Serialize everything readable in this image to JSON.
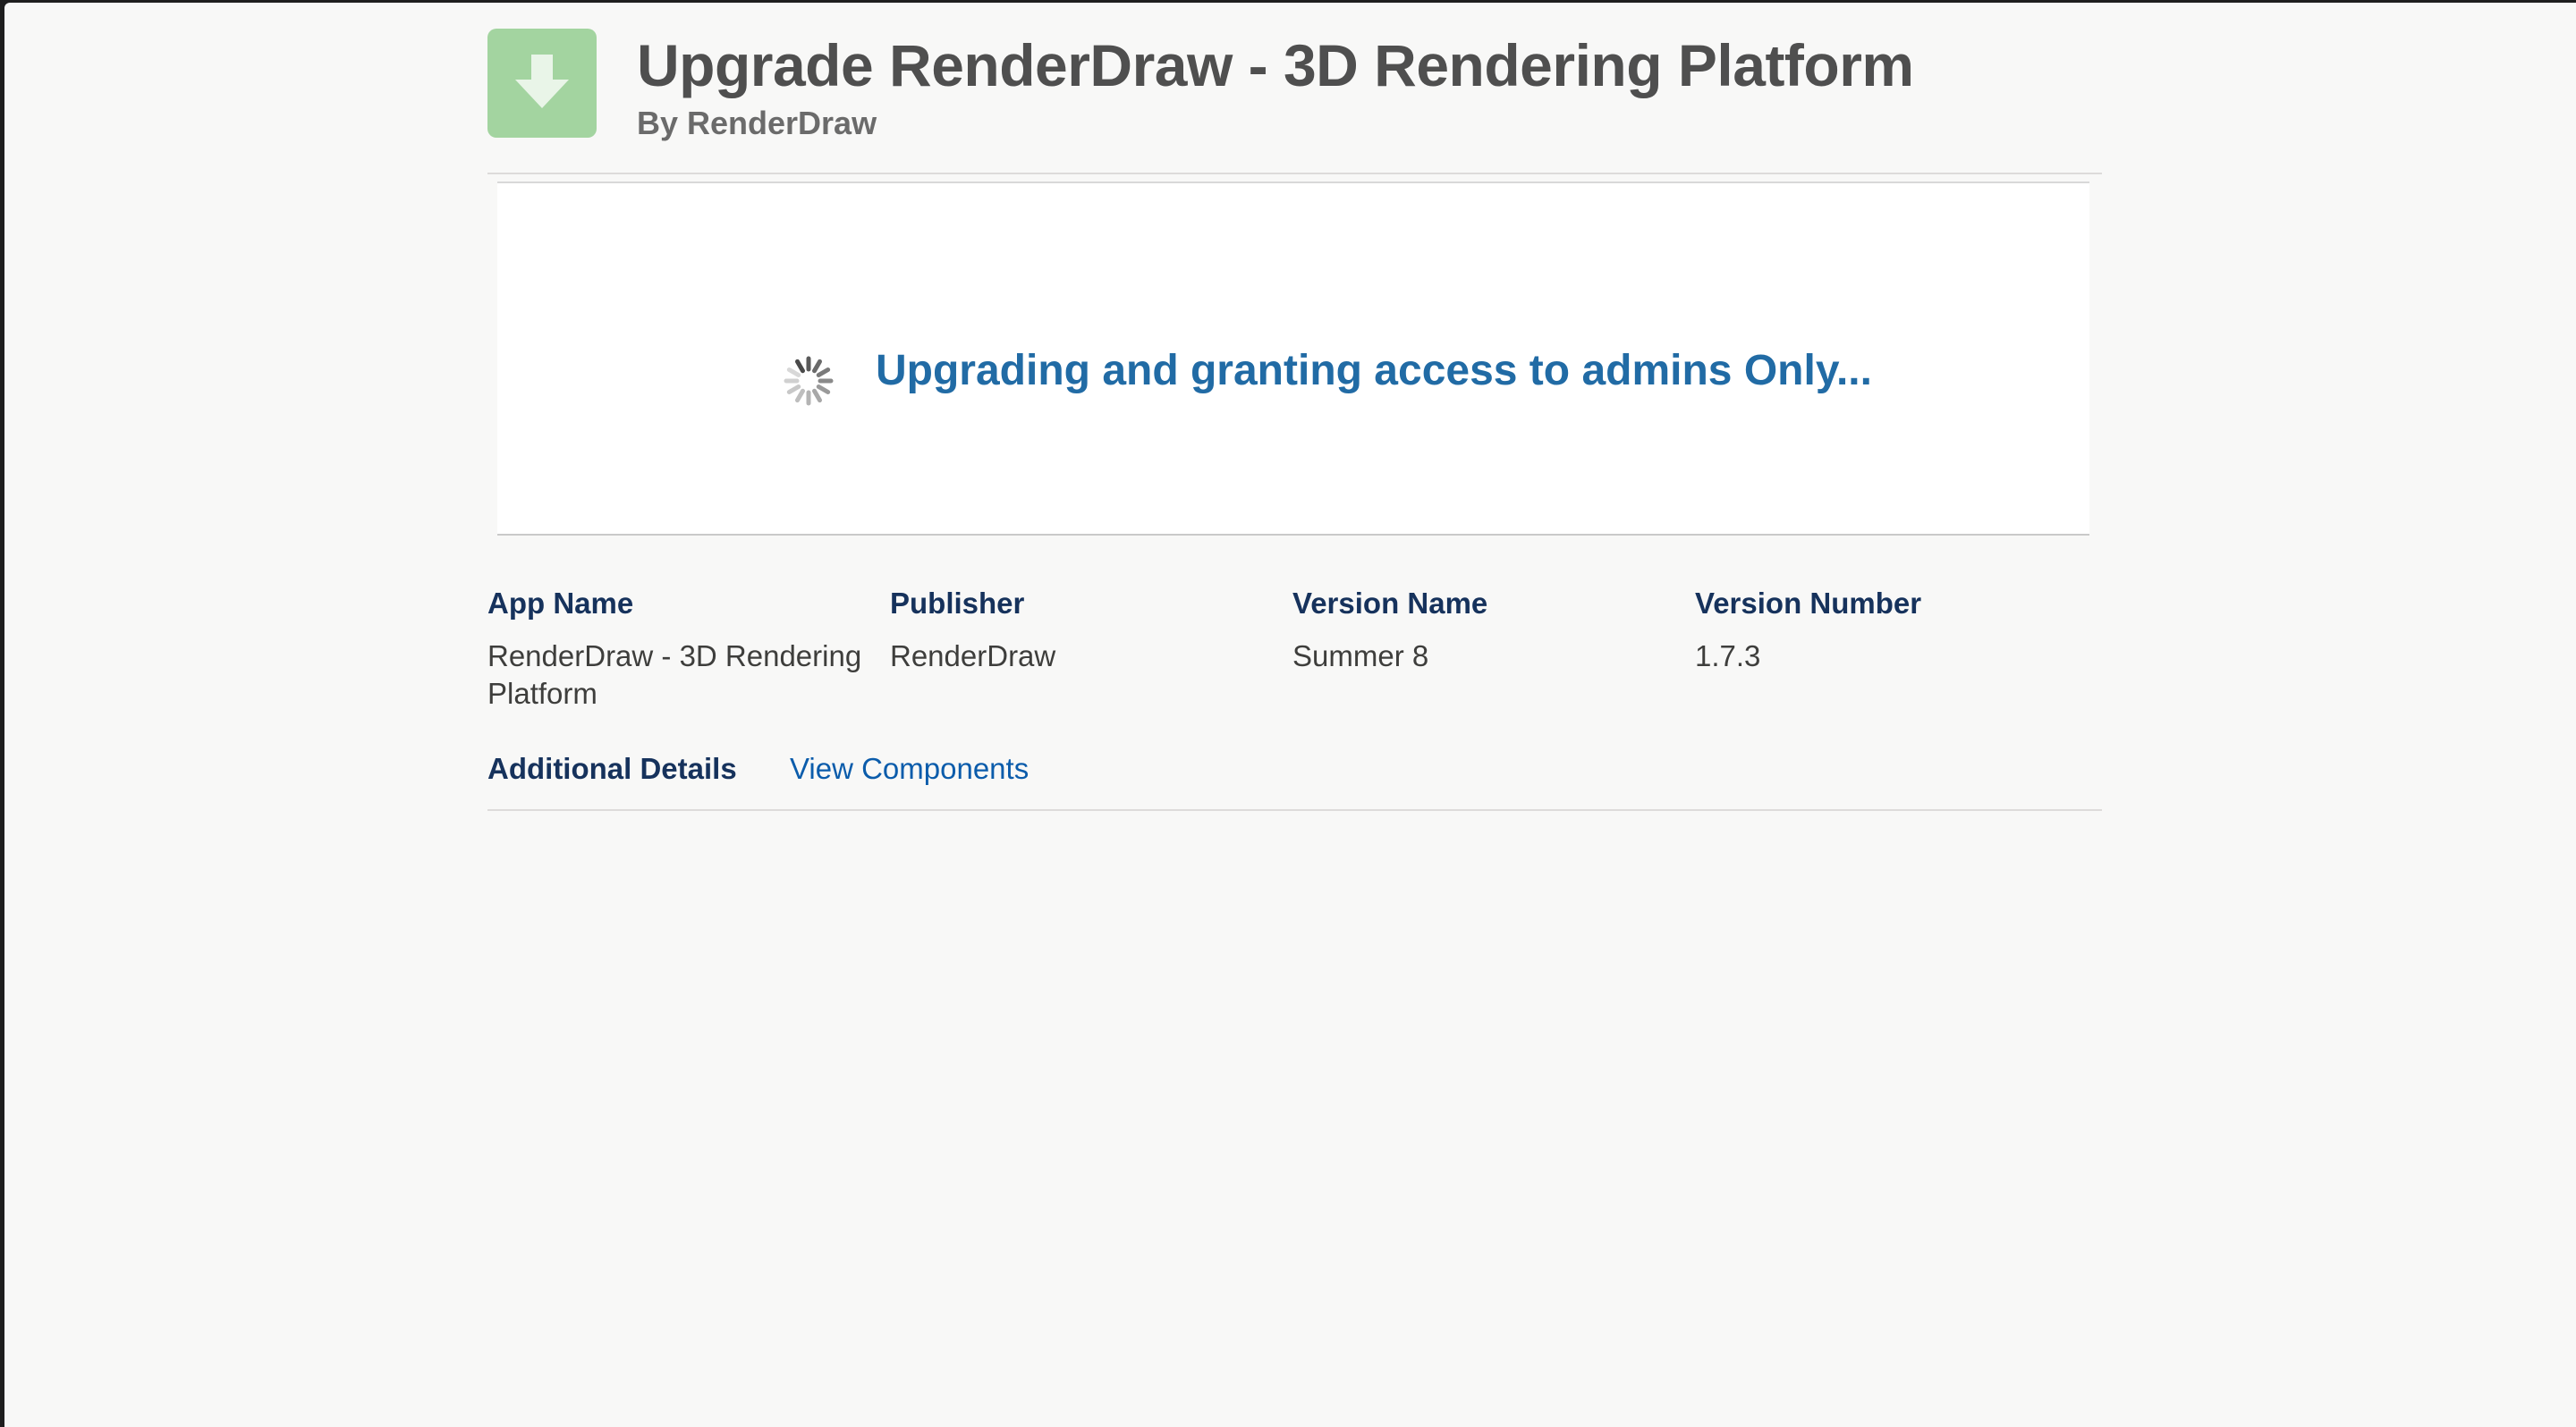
{
  "header": {
    "title": "Upgrade RenderDraw - 3D Rendering Platform",
    "subtitle": "By RenderDraw",
    "icon": "download-arrow-icon"
  },
  "status": {
    "message": "Upgrading and granting access to admins Only...",
    "icon": "spinner-icon"
  },
  "details": {
    "columns": [
      {
        "label": "App Name",
        "value": "RenderDraw - 3D Rendering Platform"
      },
      {
        "label": "Publisher",
        "value": "RenderDraw"
      },
      {
        "label": "Version Name",
        "value": "Summer 8"
      },
      {
        "label": "Version Number",
        "value": "1.7.3"
      }
    ]
  },
  "links": {
    "additional_details": "Additional Details",
    "view_components": "View Components"
  },
  "colors": {
    "accent": "#216ba5",
    "icon_bg": "#a3d4a0",
    "label": "#16325c",
    "link": "#0b5cab"
  }
}
